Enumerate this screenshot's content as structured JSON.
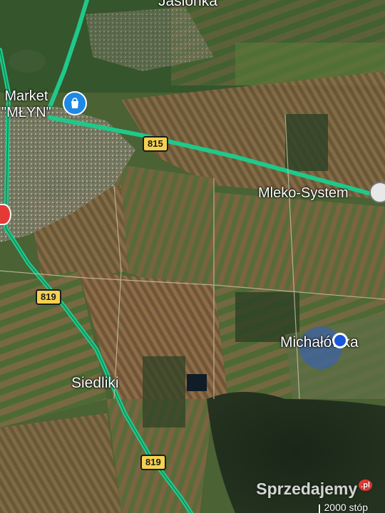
{
  "map": {
    "type": "satellite",
    "places": {
      "top_town": "Jasionka",
      "siedliki": "Siedliki",
      "michalowka": "Michałówka"
    },
    "pois": {
      "market": "Market\n\"MŁYN\"",
      "mleko": "Mleko-System"
    },
    "roads": {
      "r815": "815",
      "r819_upper": "819",
      "r819_lower": "819"
    },
    "scale": "2000 stóp"
  },
  "watermark": {
    "text": "Sprzedajemy",
    "suffix": ".pl"
  },
  "colors": {
    "road": "#1fc98a",
    "field_dark": "#2f4326",
    "field_brown": "#8a6a45",
    "forest": "#1d2a1a",
    "location": "#1a56db"
  }
}
